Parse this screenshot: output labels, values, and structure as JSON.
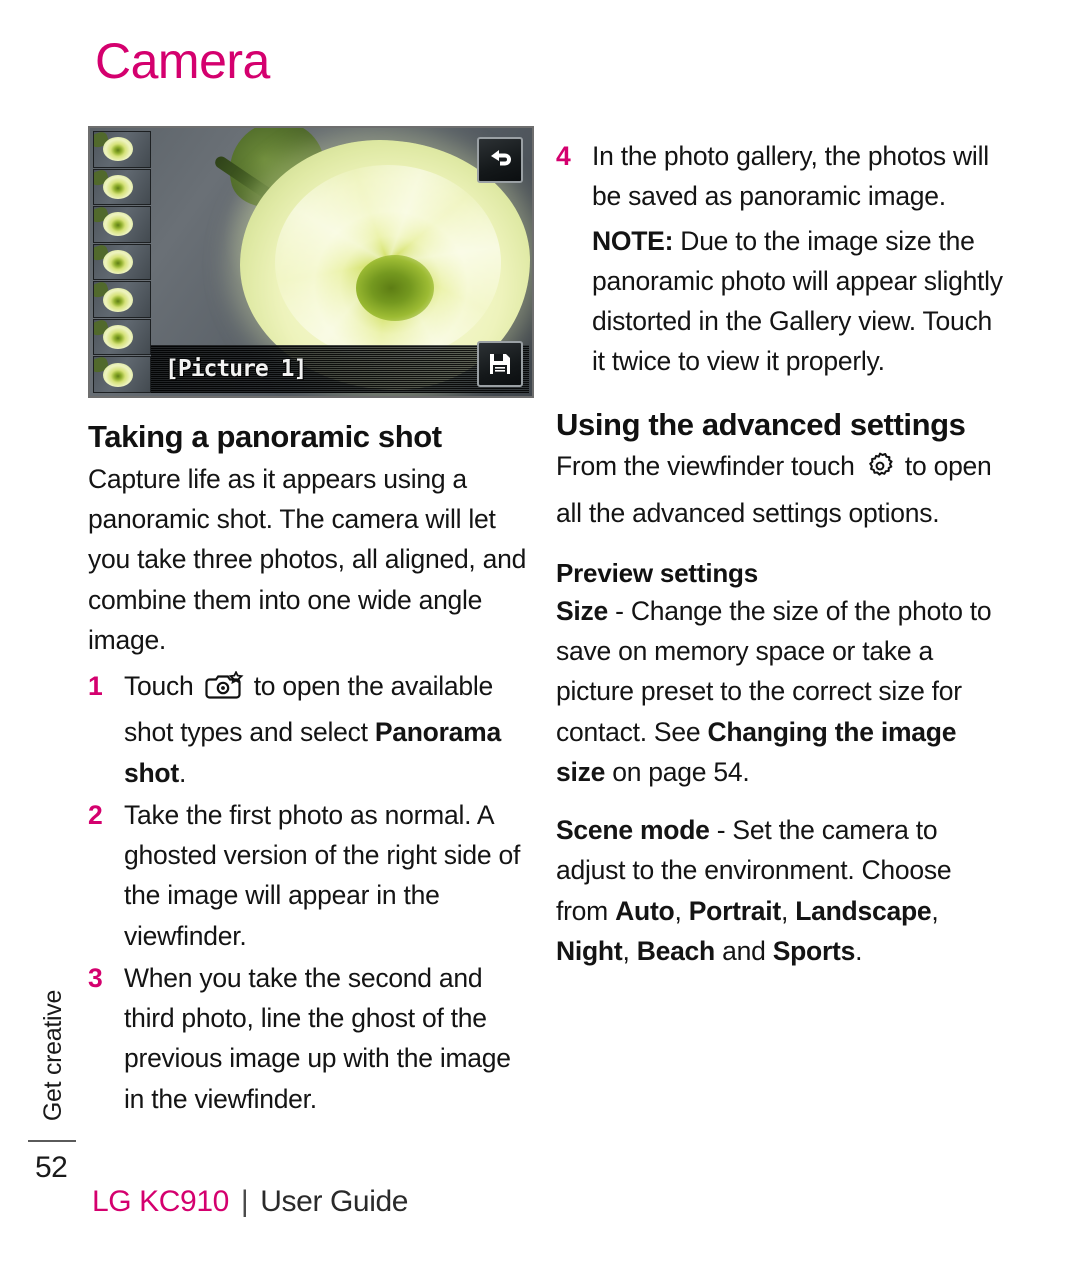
{
  "chapter": {
    "title": "Camera"
  },
  "screenshot": {
    "caption": "[Picture 1]",
    "back_icon": "back-arrow-icon",
    "save_icon": "floppy-disk-save-icon",
    "thumbnail_count": 7
  },
  "left_column": {
    "heading": "Taking a panoramic shot",
    "intro": "Capture life as it appears using a panoramic shot. The camera will let you take three photos, all aligned, and combine them into one wide angle image.",
    "steps": [
      {
        "num": "1",
        "before_icon": "Touch ",
        "icon": "camera-shot-type-icon",
        "after_icon_plain": " to open the available shot types and select ",
        "bold": "Panorama shot",
        "tail": "."
      },
      {
        "num": "2",
        "text": "Take the first photo as normal. A ghosted version of the right side of the image will appear in the viewfinder."
      },
      {
        "num": "3",
        "text": "When you take the second and third photo, line the ghost of the previous image up with the image in the viewfinder."
      }
    ]
  },
  "right_column": {
    "step4": {
      "num": "4",
      "text": "In the photo gallery, the photos will be saved as panoramic image."
    },
    "note": {
      "label": "NOTE:",
      "text": " Due to the image size the panoramic photo will appear slightly distorted in the Gallery view. Touch it twice to view it properly."
    },
    "heading": "Using the advanced settings",
    "intro_before": "From the viewfinder touch ",
    "intro_icon": "gear-settings-icon",
    "intro_after": " to open all the advanced settings options.",
    "preview_heading": "Preview settings",
    "size_para": {
      "term": "Size",
      "body1": " - Change the size of the photo to save on memory space or take a picture preset to the correct size for contact. See ",
      "bold_ref": "Changing the image size",
      "body2": " on page 54."
    },
    "scene_para": {
      "term": "Scene mode",
      "body1": " - Set the camera to adjust to the environment. Choose from ",
      "opt1": "Auto",
      "sep1": ", ",
      "opt2": "Portrait",
      "sep2": ", ",
      "opt3": "Landscape",
      "sep3": ", ",
      "opt4": "Night",
      "sep4": ", ",
      "opt5": "Beach",
      "sep5": " and ",
      "opt6": "Sports",
      "tail": "."
    }
  },
  "side_tab": {
    "label": "Get creative"
  },
  "page_number": "52",
  "footer": {
    "brand": "LG KC910",
    "divider": "|",
    "guide": "User Guide"
  },
  "colors": {
    "accent": "#d4006e",
    "text": "#141414"
  }
}
